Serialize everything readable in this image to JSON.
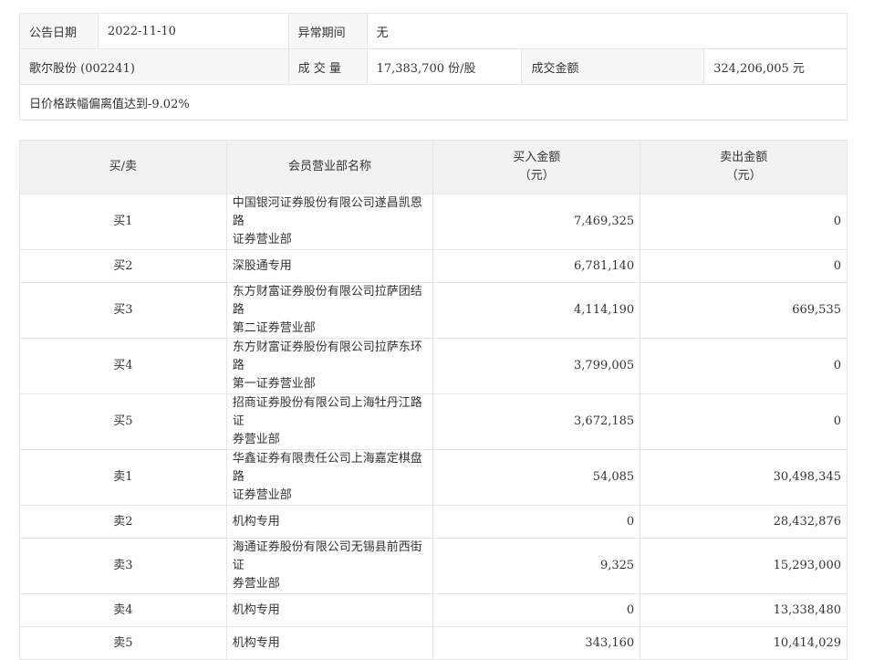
{
  "summary": {
    "date_label": "公告日期",
    "date_value": "2022-11-10",
    "period_label": "异常期间",
    "period_value": "无",
    "stock_label": "歌尔股份 (002241)",
    "volume_label": "成 交 量",
    "volume_value": "17,383,700 份/股",
    "amount_label": "成交金额",
    "amount_value": "324,206,005 元",
    "reason": "日价格跌幅偏离值达到-9.02%"
  },
  "trades": {
    "headers": {
      "side": "买/卖",
      "member": "会员营业部名称",
      "buy_line1": "买入金额",
      "buy_line2": "（元）",
      "sell_line1": "卖出金额",
      "sell_line2": "（元）"
    },
    "rows": [
      {
        "side": "买1",
        "name1": "中国银河证券股份有限公司遂昌凯恩路",
        "name2": "证券营业部",
        "buy": "7,469,325",
        "sell": "0"
      },
      {
        "side": "买2",
        "name1": "深股通专用",
        "name2": "",
        "buy": "6,781,140",
        "sell": "0"
      },
      {
        "side": "买3",
        "name1": "东方财富证券股份有限公司拉萨团结路",
        "name2": "第二证券营业部",
        "buy": "4,114,190",
        "sell": "669,535"
      },
      {
        "side": "买4",
        "name1": "东方财富证券股份有限公司拉萨东环路",
        "name2": "第一证券营业部",
        "buy": "3,799,005",
        "sell": "0"
      },
      {
        "side": "买5",
        "name1": "招商证券股份有限公司上海牡丹江路证",
        "name2": "券营业部",
        "buy": "3,672,185",
        "sell": "0"
      },
      {
        "side": "卖1",
        "name1": "华鑫证券有限责任公司上海嘉定棋盘路",
        "name2": "证券营业部",
        "buy": "54,085",
        "sell": "30,498,345"
      },
      {
        "side": "卖2",
        "name1": "机构专用",
        "name2": "",
        "buy": "0",
        "sell": "28,432,876"
      },
      {
        "side": "卖3",
        "name1": "海通证券股份有限公司无锡县前西街证",
        "name2": "券营业部",
        "buy": "9,325",
        "sell": "15,293,000"
      },
      {
        "side": "卖4",
        "name1": "机构专用",
        "name2": "",
        "buy": "0",
        "sell": "13,338,480"
      },
      {
        "side": "卖5",
        "name1": "机构专用",
        "name2": "",
        "buy": "343,160",
        "sell": "10,414,029"
      }
    ]
  }
}
